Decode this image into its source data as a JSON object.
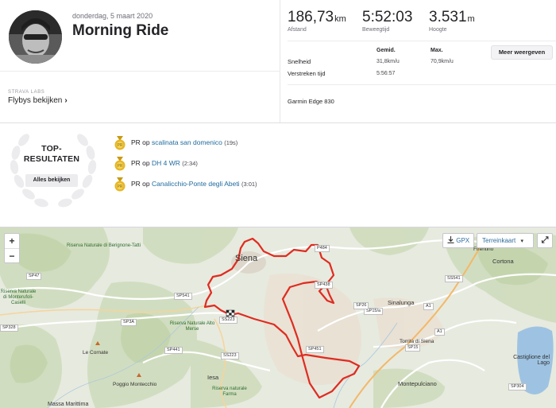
{
  "activity": {
    "date": "donderdag, 5 maart 2020",
    "title": "Morning Ride"
  },
  "labs": {
    "label": "STRAVA LABS",
    "flybys": "Flybys bekijken",
    "chevron": "›"
  },
  "stats": [
    {
      "value": "186,73",
      "unit": "km",
      "label": "Afstand"
    },
    {
      "value": "5:52:03",
      "unit": "",
      "label": "Beweegtijd"
    },
    {
      "value": "3.531",
      "unit": "m",
      "label": "Hoogte"
    }
  ],
  "details": {
    "col_avg": "Gemid.",
    "col_max": "Max.",
    "more_button": "Meer weergeven",
    "speed_label": "Snelheid",
    "speed_avg": "31,8km/u",
    "speed_max": "70,9km/u",
    "elapsed_label": "Verstreken tijd",
    "elapsed_value": "5:56:57",
    "device": "Garmin Edge 830"
  },
  "achievements": {
    "title_line1": "TOP-",
    "title_line2": "RESULTATEN",
    "all_button": "Alles bekijken",
    "items": [
      {
        "prefix": "PR op ",
        "segment": "scalinata san domenico",
        "time": "(19s)"
      },
      {
        "prefix": "PR op ",
        "segment": "DH 4 WR",
        "time": "(2:34)"
      },
      {
        "prefix": "PR op ",
        "segment": "Canalicchio-Ponte degli Abeti",
        "time": "(3:01)"
      }
    ],
    "medal_color": "#e6b624"
  },
  "map": {
    "zoom_in": "+",
    "zoom_out": "−",
    "gpx": "GPX",
    "terrain": "Terreinkaart",
    "terrain_caret": "▾",
    "fullscreen_icon": "⤢",
    "route_color": "#e02b20",
    "cities": {
      "siena": "Siena",
      "sinalunga": "Sinalunga",
      "cortona": "Cortona",
      "montepulciano": "Montepulciano",
      "castiglione": "Castiglione del Lago",
      "firenze": "Firentino",
      "torrita": "Torrita di Siena",
      "iesa": "Iesa",
      "le_cornate": "Le Cornate",
      "poggio": "Poggio Montecchio",
      "massa": "Massa Marittima"
    },
    "reserves": {
      "berignone": "Riserva Naturale di Berignone-Tatti",
      "montioni": "Riserva Naturale di Monterufoli-Caselli",
      "merse": "Riserva Naturale Alto Merse",
      "farma": "Riserva naturale Farma"
    },
    "roads": {
      "sp47": "SP47",
      "sp541": "SP541",
      "sp3a": "SP3A",
      "sp328": "SP328",
      "sp441": "SP441",
      "ss223": "SS223",
      "ss223b": "SS223",
      "p484": "P484",
      "sp438": "SP438",
      "sp15a": "SP15/a",
      "a1a": "A1",
      "a1b": "A1",
      "sp451": "SP451",
      "sp15": "SP15",
      "sp304": "SP304",
      "sp26": "SP26",
      "ss541b": "SS541"
    }
  }
}
